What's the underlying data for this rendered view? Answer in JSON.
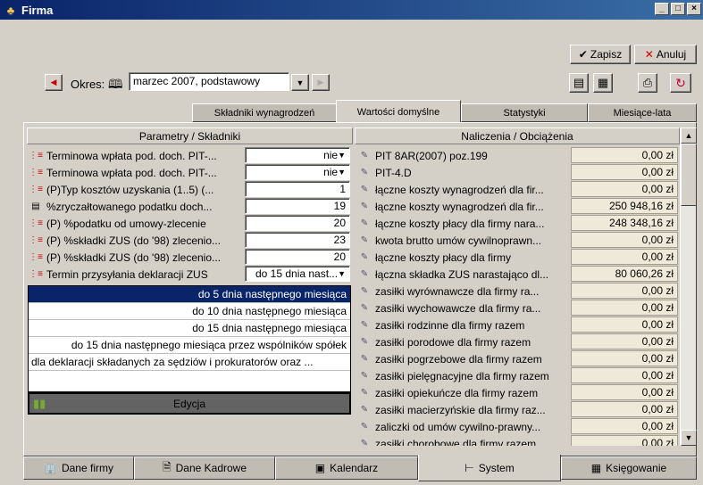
{
  "window": {
    "title": "Firma",
    "minimize": "_",
    "maximize": "□",
    "close": "×"
  },
  "toolbar": {
    "save_label": "Zapisz",
    "cancel_label": "Anuluj"
  },
  "period": {
    "label": "Okres:",
    "value": "marzec 2007, podstawowy"
  },
  "top_tabs": [
    "Składniki wynagrodzeń",
    "Wartości domyślne",
    "Statystyki",
    "Miesiące-lata"
  ],
  "left_panel": {
    "header": "Parametry / Składniki",
    "rows": [
      {
        "label": "Terminowa wpłata pod. doch. PIT-...",
        "value": "nie",
        "dropdown": true
      },
      {
        "label": "Terminowa wpłata pod. doch. PIT-...",
        "value": "nie",
        "dropdown": true
      },
      {
        "label": "(P)Typ kosztów uzyskania (1..5) (...",
        "value": "1"
      },
      {
        "label": "%zryczałtowanego podatku doch...",
        "value": "19"
      },
      {
        "label": "(P) %podatku od umowy-zlecenie",
        "value": "20"
      },
      {
        "label": "(P) %składki ZUS (do '98) zlecenio...",
        "value": "23"
      },
      {
        "label": "(P) %składki ZUS (do '98) zlecenio...",
        "value": "20"
      },
      {
        "label": "Termin przysyłania deklaracji ZUS",
        "value": "do 15 dnia nast...",
        "dropdown": true
      }
    ],
    "options": [
      "do 5 dnia następnego miesiąca",
      "do 10 dnia następnego miesiąca",
      "do 15 dnia następnego miesiąca",
      "do 15 dnia następnego miesiąca przez wspólników spółek",
      "dla deklaracji składanych za sędziów i prokuratorów oraz ..."
    ],
    "edit_label": "Edycja"
  },
  "right_panel": {
    "header": "Naliczenia / Obciążenia",
    "rows": [
      {
        "label": "PIT 8AR(2007) poz.199",
        "amount": "0,00 zł"
      },
      {
        "label": "PIT-4.D",
        "amount": "0,00 zł"
      },
      {
        "label": "łączne koszty wynagrodzeń dla fir...",
        "amount": "0,00 zł"
      },
      {
        "label": "łączne koszty wynagrodzeń dla fir...",
        "amount": "250 948,16 zł"
      },
      {
        "label": "łączne koszty płacy dla firmy nara...",
        "amount": "248 348,16 zł"
      },
      {
        "label": "kwota brutto umów cywilnoprawn...",
        "amount": "0,00 zł"
      },
      {
        "label": "łączne koszty płacy dla firmy",
        "amount": "0,00 zł"
      },
      {
        "label": "łączna składka ZUS narastająco dl...",
        "amount": "80 060,26 zł"
      },
      {
        "label": "zasiłki wyrównawcze dla firmy ra...",
        "amount": "0,00 zł"
      },
      {
        "label": "zasiłki wychowawcze dla firmy ra...",
        "amount": "0,00 zł"
      },
      {
        "label": "zasiłki rodzinne dla firmy razem",
        "amount": "0,00 zł"
      },
      {
        "label": "zasiłki porodowe dla firmy razem",
        "amount": "0,00 zł"
      },
      {
        "label": "zasiłki pogrzebowe dla firmy razem",
        "amount": "0,00 zł"
      },
      {
        "label": "zasiłki pielęgnacyjne dla firmy razem",
        "amount": "0,00 zł"
      },
      {
        "label": "zasiłki opiekuńcze dla firmy razem",
        "amount": "0,00 zł"
      },
      {
        "label": "zasiłki macierzyńskie dla firmy raz...",
        "amount": "0,00 zł"
      },
      {
        "label": "zaliczki od umów cywilno-prawny...",
        "amount": "0,00 zł"
      },
      {
        "label": "zasiłki chorobowe dla firmy razem",
        "amount": "0,00 zł"
      }
    ]
  },
  "bottom_tabs": [
    "Dane firmy",
    "Dane Kadrowe",
    "Kalendarz",
    "System",
    "Księgowanie"
  ],
  "active_bottom_tab": "System",
  "active_top_tab": "Wartości domyślne"
}
